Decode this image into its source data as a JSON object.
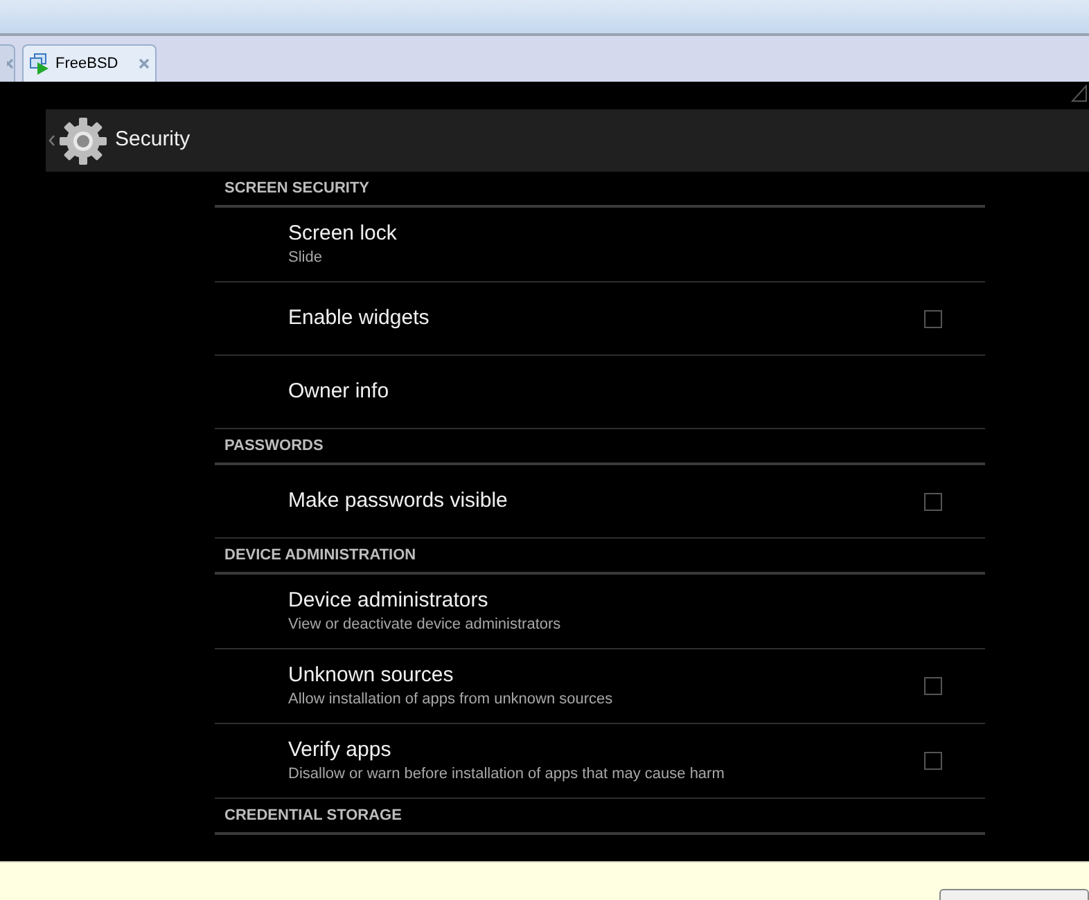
{
  "tabs": [
    {
      "kind": "partial",
      "selected": false
    },
    {
      "label": "FreeBSD",
      "selected": true
    }
  ],
  "action_bar": {
    "title": "Security"
  },
  "sections": [
    {
      "header": "SCREEN SECURITY",
      "items": [
        {
          "kind": "plain",
          "title": "Screen lock",
          "summary": "Slide"
        },
        {
          "kind": "checkbox",
          "title": "Enable widgets",
          "checked": false
        },
        {
          "kind": "plain",
          "title": "Owner info"
        }
      ]
    },
    {
      "header": "PASSWORDS",
      "items": [
        {
          "kind": "checkbox",
          "title": "Make passwords visible",
          "checked": false
        }
      ]
    },
    {
      "header": "DEVICE ADMINISTRATION",
      "items": [
        {
          "kind": "plain",
          "title": "Device administrators",
          "summary": "View or deactivate device administrators"
        },
        {
          "kind": "checkbox",
          "title": "Unknown sources",
          "summary": "Allow installation of apps from unknown sources",
          "checked": false
        },
        {
          "kind": "checkbox",
          "title": "Verify apps",
          "summary": "Disallow or warn before installation of apps that may cause harm",
          "checked": false
        }
      ]
    },
    {
      "header": "CREDENTIAL STORAGE"
    }
  ]
}
